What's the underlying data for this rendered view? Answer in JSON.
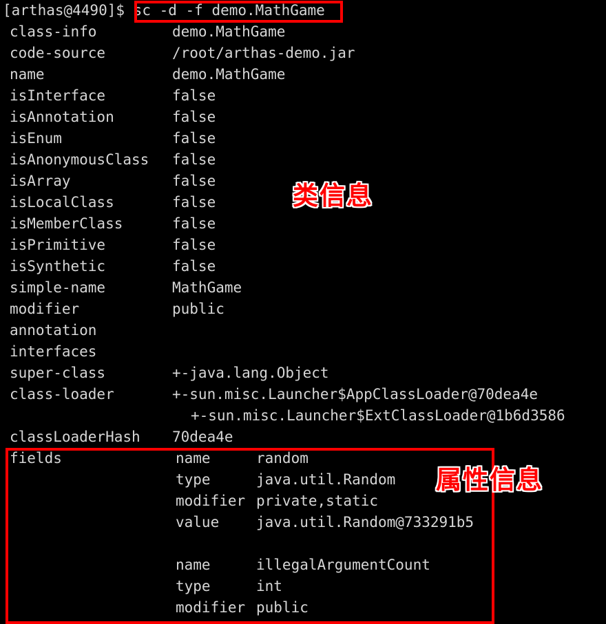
{
  "terminal": {
    "prompt": "[arthas@4490]$",
    "command": "sc -d -f demo.MathGame",
    "rows": [
      {
        "key": "class-info",
        "value": "demo.MathGame"
      },
      {
        "key": "code-source",
        "value": "/root/arthas-demo.jar"
      },
      {
        "key": "name",
        "value": "demo.MathGame"
      },
      {
        "key": "isInterface",
        "value": "false"
      },
      {
        "key": "isAnnotation",
        "value": "false"
      },
      {
        "key": "isEnum",
        "value": "false"
      },
      {
        "key": "isAnonymousClass",
        "value": "false"
      },
      {
        "key": "isArray",
        "value": "false"
      },
      {
        "key": "isLocalClass",
        "value": "false"
      },
      {
        "key": "isMemberClass",
        "value": "false"
      },
      {
        "key": "isPrimitive",
        "value": "false"
      },
      {
        "key": "isSynthetic",
        "value": "false"
      },
      {
        "key": "simple-name",
        "value": "MathGame"
      },
      {
        "key": "modifier",
        "value": "public"
      },
      {
        "key": "annotation",
        "value": ""
      },
      {
        "key": "interfaces",
        "value": ""
      },
      {
        "key": "super-class",
        "value": "+-java.lang.Object"
      },
      {
        "key": "class-loader",
        "value": "+-sun.misc.Launcher$AppClassLoader@70dea4e"
      },
      {
        "key": "",
        "value": "+-sun.misc.Launcher$ExtClassLoader@1b6d3586"
      },
      {
        "key": "classLoaderHash",
        "value": "70dea4e"
      }
    ],
    "fields_label": "fields",
    "fields": [
      {
        "name_key": "name",
        "name_value": "random",
        "type_key": "type",
        "type_value": "java.util.Random",
        "modifier_key": "modifier",
        "modifier_value": "private,static",
        "value_key": "value",
        "value_value": "java.util.Random@733291b5"
      },
      {
        "name_key": "name",
        "name_value": "illegalArgumentCount",
        "type_key": "type",
        "type_value": "int",
        "modifier_key": "modifier",
        "modifier_value": "public"
      }
    ]
  },
  "annotations": {
    "class_info_label": "类信息",
    "fields_info_label": "属性信息",
    "box_color": "#ff0000"
  },
  "colors": {
    "background": "#000000",
    "foreground": "#d6d6d6",
    "highlight": "#ff0000"
  }
}
